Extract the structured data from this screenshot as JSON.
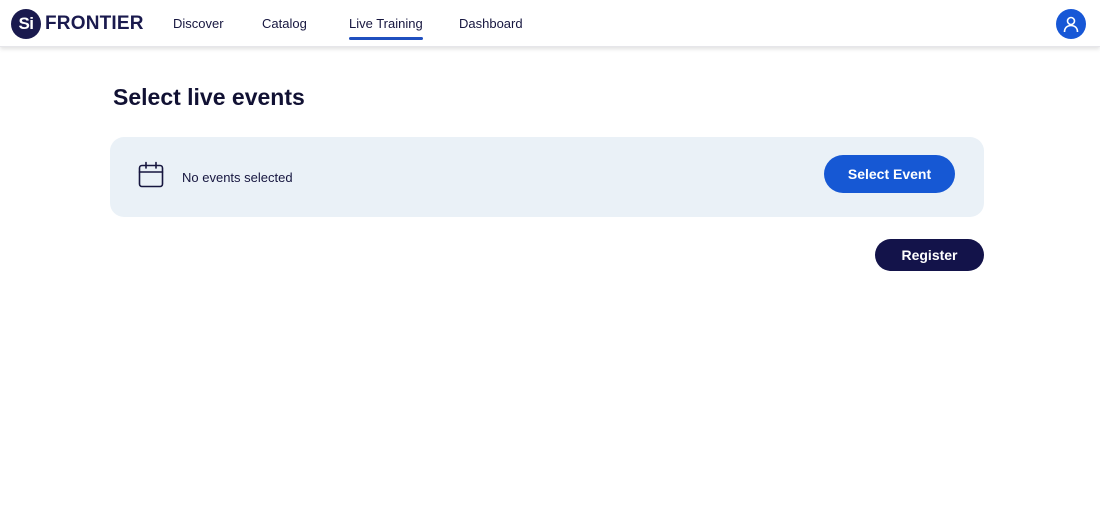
{
  "header": {
    "logo_badge": "Si",
    "logo_text": "FRONTIER",
    "nav": [
      {
        "label": "Discover"
      },
      {
        "label": "Catalog"
      },
      {
        "label": "Live Training",
        "active": true
      },
      {
        "label": "Dashboard"
      }
    ],
    "avatar_icon": "user-icon"
  },
  "main": {
    "title": "Select live events",
    "panel": {
      "icon": "calendar-icon",
      "text": "No events selected",
      "button_label": "Select Event"
    },
    "register_label": "Register"
  },
  "colors": {
    "brand_navy": "#1a1a4e",
    "accent_blue": "#1658d4",
    "panel_bg": "#eaf1f7",
    "register_bg": "#13134a"
  }
}
